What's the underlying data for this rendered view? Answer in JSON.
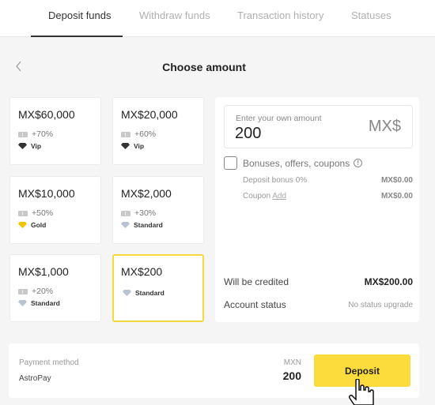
{
  "tabs": [
    {
      "label": "Deposit funds",
      "active": true
    },
    {
      "label": "Withdraw funds",
      "active": false
    },
    {
      "label": "Transaction history",
      "active": false
    },
    {
      "label": "Statuses",
      "active": false
    }
  ],
  "header": {
    "title": "Choose amount",
    "back_icon": "chevron-left-icon"
  },
  "amount_options": [
    {
      "amount": "MX$60,000",
      "bonus": "+70%",
      "tier": "Vip",
      "tier_icon": "vip-diamond-icon",
      "tier_color": "#333333",
      "selected": false
    },
    {
      "amount": "MX$20,000",
      "bonus": "+60%",
      "tier": "Vip",
      "tier_icon": "vip-diamond-icon",
      "tier_color": "#333333",
      "selected": false
    },
    {
      "amount": "MX$10,000",
      "bonus": "+50%",
      "tier": "Gold",
      "tier_icon": "gold-diamond-icon",
      "tier_color": "#f2c200",
      "selected": false
    },
    {
      "amount": "MX$2,000",
      "bonus": "+30%",
      "tier": "Standard",
      "tier_icon": "standard-diamond-icon",
      "tier_color": "#b8c2d0",
      "selected": false
    },
    {
      "amount": "MX$1,000",
      "bonus": "+20%",
      "tier": "Standard",
      "tier_icon": "standard-diamond-icon",
      "tier_color": "#b8c2d0",
      "selected": false
    },
    {
      "amount": "MX$200",
      "bonus": null,
      "tier": "Standard",
      "tier_icon": "standard-diamond-icon",
      "tier_color": "#b8c2d0",
      "selected": true
    }
  ],
  "custom_amount": {
    "label": "Enter your own amount",
    "value": "200",
    "currency": "MX$"
  },
  "bonuses": {
    "label": "Bonuses, offers, coupons",
    "checked": false,
    "info_icon": "info-icon",
    "deposit_bonus_label": "Deposit bonus 0%",
    "deposit_bonus_value": "MX$0.00",
    "coupon_label": "Coupon",
    "coupon_link": "Add",
    "coupon_value": "MX$0.00"
  },
  "summary": {
    "credited_label": "Will be credited",
    "credited_value": "MX$200.00",
    "status_label": "Account status",
    "status_value": "No status upgrade"
  },
  "payment": {
    "method_label": "Payment method",
    "method_value": "AstroPay",
    "currency": "MXN",
    "amount": "200",
    "deposit_label": "Deposit"
  },
  "colors": {
    "accent": "#fcdc3c",
    "selected_border": "#f3d93a"
  }
}
